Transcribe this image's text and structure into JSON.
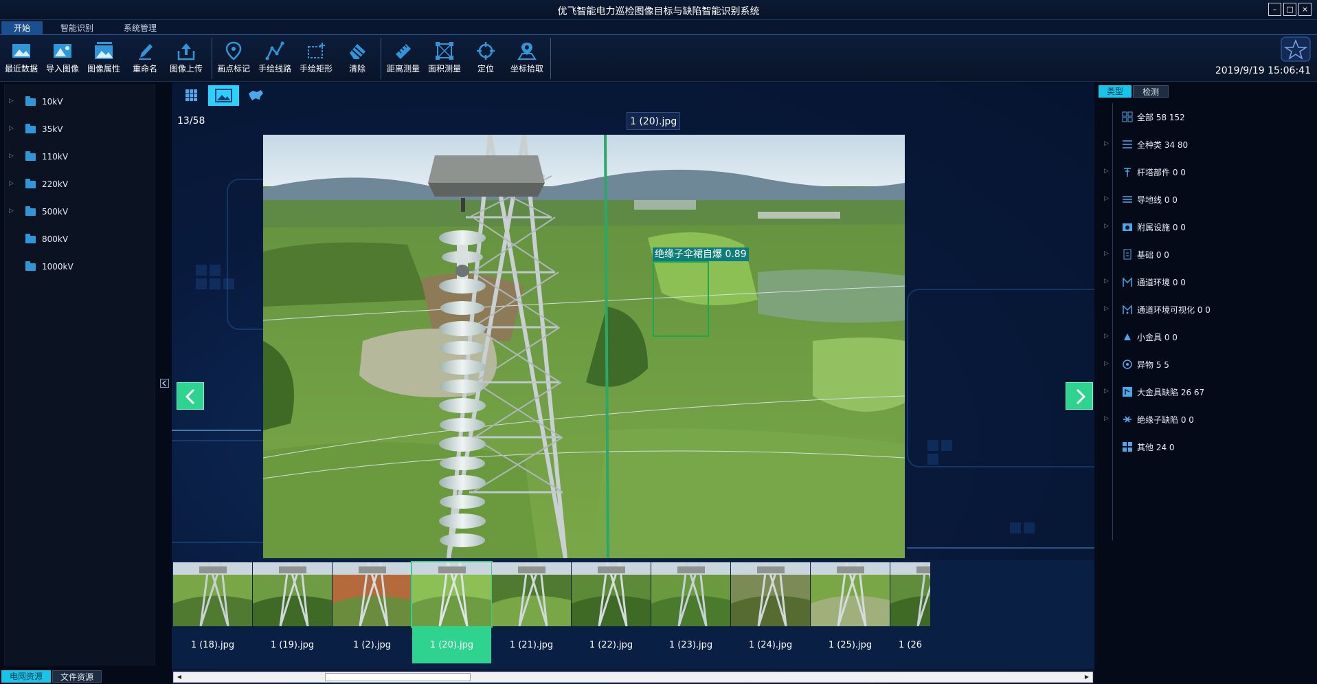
{
  "window": {
    "title": "优飞智能电力巡检图像目标与缺陷智能识别系统",
    "minimize": "–",
    "maximize": "□",
    "close": "×"
  },
  "menu_tabs": [
    "开始",
    "智能识别",
    "系统管理"
  ],
  "toolbar": {
    "groups": [
      [
        {
          "label": "最近数据",
          "icon": "recent-image-icon"
        },
        {
          "label": "导入图像",
          "icon": "import-image-icon"
        },
        {
          "label": "图像属性",
          "icon": "image-properties-icon"
        },
        {
          "label": "重命名",
          "icon": "rename-pen-icon"
        },
        {
          "label": "图像上传",
          "icon": "upload-icon"
        }
      ],
      [
        {
          "label": "画点标记",
          "icon": "point-marker-icon"
        },
        {
          "label": "手绘线路",
          "icon": "polyline-icon"
        },
        {
          "label": "手绘矩形",
          "icon": "rectangle-icon"
        },
        {
          "label": "清除",
          "icon": "eraser-icon"
        }
      ],
      [
        {
          "label": "距离测量",
          "icon": "ruler-icon"
        },
        {
          "label": "面积测量",
          "icon": "area-icon"
        },
        {
          "label": "定位",
          "icon": "crosshair-icon"
        },
        {
          "label": "坐标拾取",
          "icon": "coordinate-pin-icon"
        }
      ]
    ]
  },
  "datetime": "2019/9/19 15:06:41",
  "left_tree": [
    "10kV",
    "35kV",
    "110kV",
    "220kV",
    "500kV",
    "800kV",
    "1000kV"
  ],
  "left_tree_expandable": [
    true,
    true,
    true,
    true,
    true,
    false,
    false
  ],
  "left_tabs": [
    "电网资源",
    "文件资源"
  ],
  "viewer": {
    "view_modes": [
      "grid-view-icon",
      "image-view-icon",
      "map-view-icon"
    ],
    "counter": "13/58",
    "filename": "1 (20).jpg",
    "detection": {
      "label": "绝缘子伞裙自爆 0.89",
      "color": "#1ea84a"
    }
  },
  "filmstrip": {
    "items": [
      "1 (18).jpg",
      "1 (19).jpg",
      "1 (2).jpg",
      "1 (20).jpg",
      "1 (21).jpg",
      "1 (22).jpg",
      "1 (23).jpg",
      "1 (24).jpg",
      "1 (25).jpg",
      "1 (26"
    ],
    "selected_index": 3,
    "selected_color": "#2ed38f"
  },
  "right_tabs": [
    "类型",
    "检测"
  ],
  "right_list": [
    {
      "label": "全部 58 152",
      "icon": "grid-icon",
      "expandable": false
    },
    {
      "label": "全种类 34 80",
      "icon": "list-icon",
      "expandable": true
    },
    {
      "label": "杆塔部件 0 0",
      "icon": "tower-icon",
      "expandable": true
    },
    {
      "label": "导地线 0 0",
      "icon": "wire-icon",
      "expandable": true
    },
    {
      "label": "附属设施 0 0",
      "icon": "camera-icon",
      "expandable": true
    },
    {
      "label": "基础 0 0",
      "icon": "foundation-icon",
      "expandable": true
    },
    {
      "label": "通道环境 0 0",
      "icon": "channel-icon",
      "expandable": true
    },
    {
      "label": "通道环境可视化 0 0",
      "icon": "channel-visual-icon",
      "expandable": true
    },
    {
      "label": "小金具 0 0",
      "icon": "fitting-icon",
      "expandable": true
    },
    {
      "label": "异物 5 5",
      "icon": "foreign-object-icon",
      "expandable": true
    },
    {
      "label": "大金具缺陷 26 67",
      "icon": "large-fitting-icon",
      "expandable": true
    },
    {
      "label": "绝缘子缺陷 0 0",
      "icon": "insulator-icon",
      "expandable": true
    },
    {
      "label": "其他 24 0",
      "icon": "other-grid-icon",
      "expandable": false
    }
  ],
  "colors": {
    "accent": "#2ed38f",
    "tab_active": "#18c5e8",
    "folder": "#2f97d8"
  }
}
